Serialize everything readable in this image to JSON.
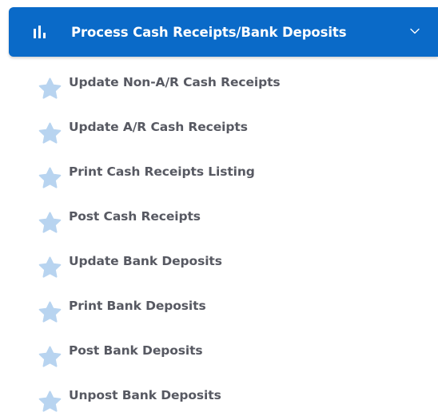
{
  "header": {
    "title": "Process Cash Receipts/Bank Deposits",
    "icon": "bar-chart-icon",
    "toggle_icon": "chevron-down-icon",
    "background_color": "#0a6ac8",
    "text_color": "#ffffff"
  },
  "menu": {
    "item_icon": "star-icon",
    "star_color": "#b8d4f0",
    "label_color": "#575962",
    "items": [
      {
        "label": "Update Non-A/R Cash Receipts"
      },
      {
        "label": "Update A/R Cash Receipts"
      },
      {
        "label": "Print Cash Receipts Listing"
      },
      {
        "label": "Post Cash Receipts"
      },
      {
        "label": "Update Bank Deposits"
      },
      {
        "label": "Print Bank Deposits"
      },
      {
        "label": "Post Bank Deposits"
      },
      {
        "label": "Unpost Bank Deposits"
      }
    ]
  }
}
